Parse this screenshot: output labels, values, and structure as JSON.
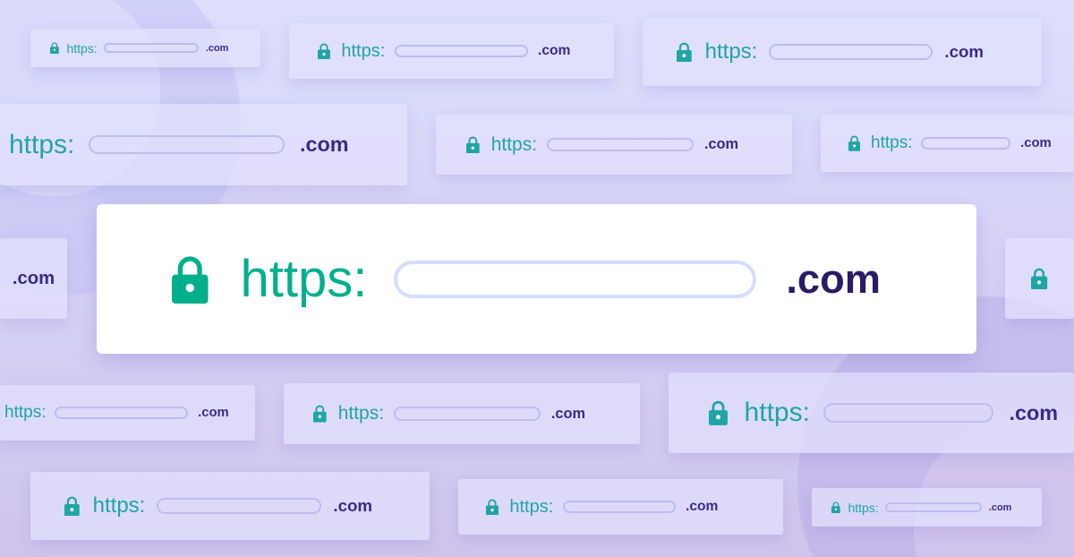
{
  "url_bar": {
    "scheme": "https:",
    "domain_suffix": ".com",
    "address_value": ""
  },
  "colors": {
    "secure_green": "#00b08c",
    "teal_faded": "#1fa5a5",
    "domain_purple": "#2b1b66",
    "background": "#d6d2f6"
  },
  "icons": {
    "lock": "lock-icon"
  }
}
